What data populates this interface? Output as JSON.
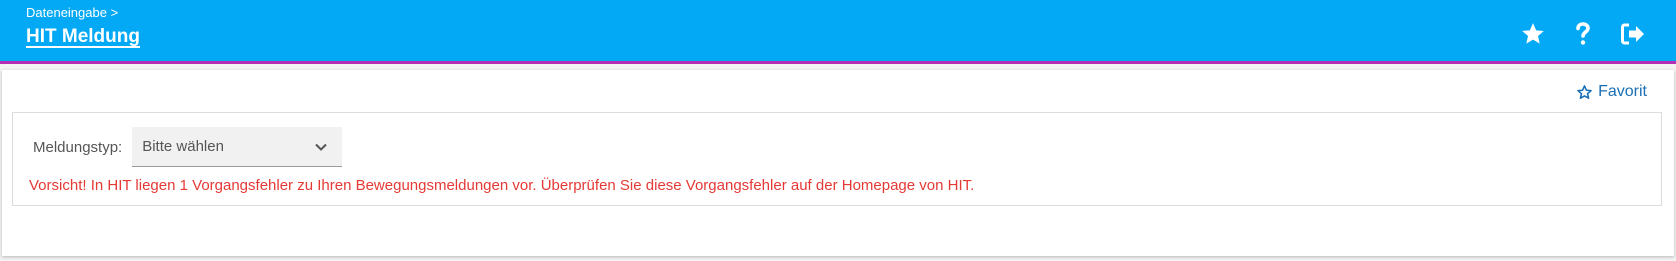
{
  "header": {
    "breadcrumb": "Dateneingabe >",
    "title": "HIT Meldung",
    "icons": [
      "star-icon",
      "help-icon",
      "logout-icon"
    ],
    "background_color": "#03a9f4",
    "accent_color": "#b52fb5"
  },
  "card": {
    "favorite_label": "Favorit",
    "favorite_icon": "star-outline-icon",
    "field": {
      "label": "Meldungstyp:",
      "value": "Bitte wählen",
      "icon": "chevron-down-icon"
    },
    "warning": "Vorsicht! In HIT liegen 1 Vorgangsfehler zu Ihren Bewegungsmeldungen vor. Überprüfen Sie diese Vorgangsfehler auf der Homepage von HIT.",
    "warning_color": "#e53935"
  }
}
